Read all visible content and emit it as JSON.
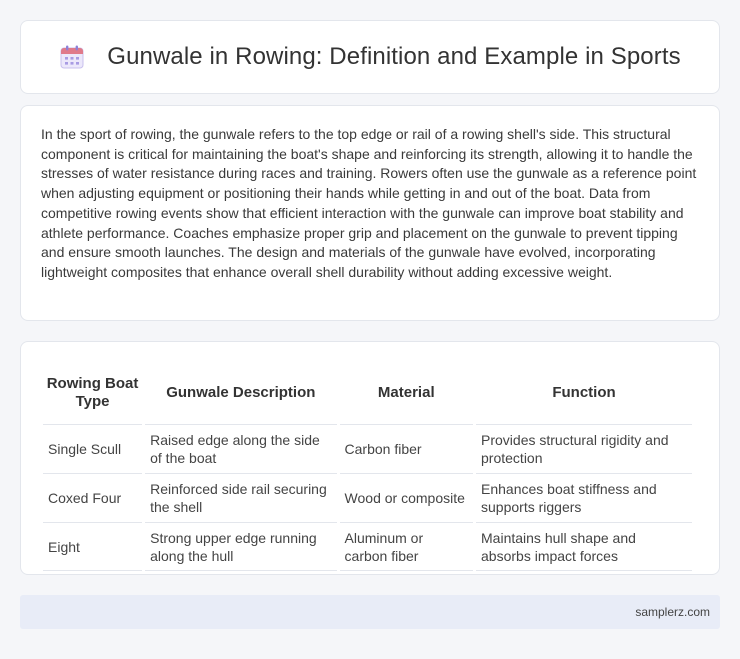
{
  "header": {
    "icon": "calendar-icon",
    "title": "Gunwale in Rowing: Definition and Example in Sports"
  },
  "article": {
    "paragraph": "In the sport of rowing, the gunwale refers to the top edge or rail of a rowing shell's side. This structural component is critical for maintaining the boat's shape and reinforcing its strength, allowing it to handle the stresses of water resistance during races and training. Rowers often use the gunwale as a reference point when adjusting equipment or positioning their hands while getting in and out of the boat. Data from competitive rowing events show that efficient interaction with the gunwale can improve boat stability and athlete performance. Coaches emphasize proper grip and placement on the gunwale to prevent tipping and ensure smooth launches. The design and materials of the gunwale have evolved, incorporating lightweight composites that enhance overall shell durability without adding excessive weight."
  },
  "table": {
    "headers": [
      "Rowing Boat Type",
      "Gunwale Description",
      "Material",
      "Function"
    ],
    "rows": [
      [
        "Single Scull",
        "Raised edge along the side of the boat",
        "Carbon fiber",
        "Provides structural rigidity and protection"
      ],
      [
        "Coxed Four",
        "Reinforced side rail securing the shell",
        "Wood or composite",
        "Enhances boat stiffness and supports riggers"
      ],
      [
        "Eight",
        "Strong upper edge running along the hull",
        "Aluminum or carbon fiber",
        "Maintains hull shape and absorbs impact forces"
      ]
    ]
  },
  "footer": {
    "site": "samplerz.com"
  },
  "colors": {
    "background": "#f5f6f9",
    "footer_bg": "#e8ecf7",
    "border": "#e3e6ec"
  }
}
